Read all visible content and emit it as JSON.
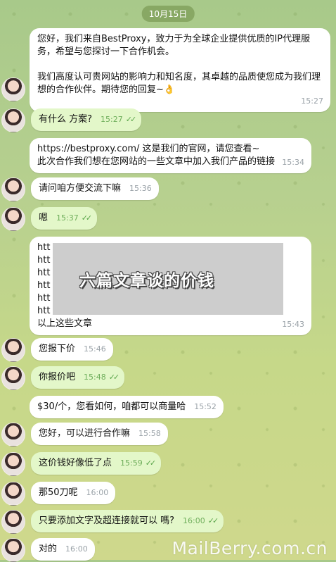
{
  "date": "10月15日",
  "messages": [
    {
      "dir": "in",
      "avatar": false,
      "text": "您好，我们来自BestProxy，致力于为全球企业提供优质的IP代理服务，希望与您探讨一下合作机会。\n\n我们高度认可贵网站的影响力和知名度，其卓越的品质使您成为我们理想的合作伙伴。期待您的回复~👌",
      "time": "15:27"
    },
    {
      "dir": "out",
      "avatar": true,
      "text": "有什么 方案?",
      "time": "15:27"
    },
    {
      "dir": "in",
      "avatar": false,
      "text": "https://bestproxy.com/ 这是我们的官网，请您查看~\n此次合作我们想在您网站的一些文章中加入我们产品的链接",
      "time": "15:34"
    },
    {
      "dir": "in",
      "avatar": true,
      "text": "请问咱方便交流下嘛",
      "time": "15:36"
    },
    {
      "dir": "out",
      "avatar": true,
      "text": "嗯",
      "time": "15:37"
    },
    {
      "dir": "in",
      "avatar": false,
      "text": "htt\nhtt\nhtt\nhtt\nhtt\nhtt\n以上这些文章",
      "time": "15:43"
    },
    {
      "dir": "in",
      "avatar": true,
      "text": "您报下价",
      "time": "15:46"
    },
    {
      "dir": "out",
      "avatar": true,
      "text": "你报价吧",
      "time": "15:48"
    },
    {
      "dir": "in",
      "avatar": false,
      "text": "$30/个，您看如何，咱都可以商量哈",
      "time": "15:52"
    },
    {
      "dir": "in",
      "avatar": true,
      "text": "您好，可以进行合作嘛",
      "time": "15:58"
    },
    {
      "dir": "out",
      "avatar": true,
      "text": "这价钱好像低了点",
      "time": "15:59"
    },
    {
      "dir": "in",
      "avatar": true,
      "text": "那50刀呢",
      "time": "16:00"
    },
    {
      "dir": "out",
      "avatar": true,
      "text": "只要添加文字及超连接就可以 嗎?",
      "time": "16:00"
    },
    {
      "dir": "in",
      "avatar": true,
      "text": "对的",
      "time": "16:00"
    }
  ],
  "overlay_label": "六篇文章谈的价钱",
  "watermark": "MailBerry.com.cn"
}
